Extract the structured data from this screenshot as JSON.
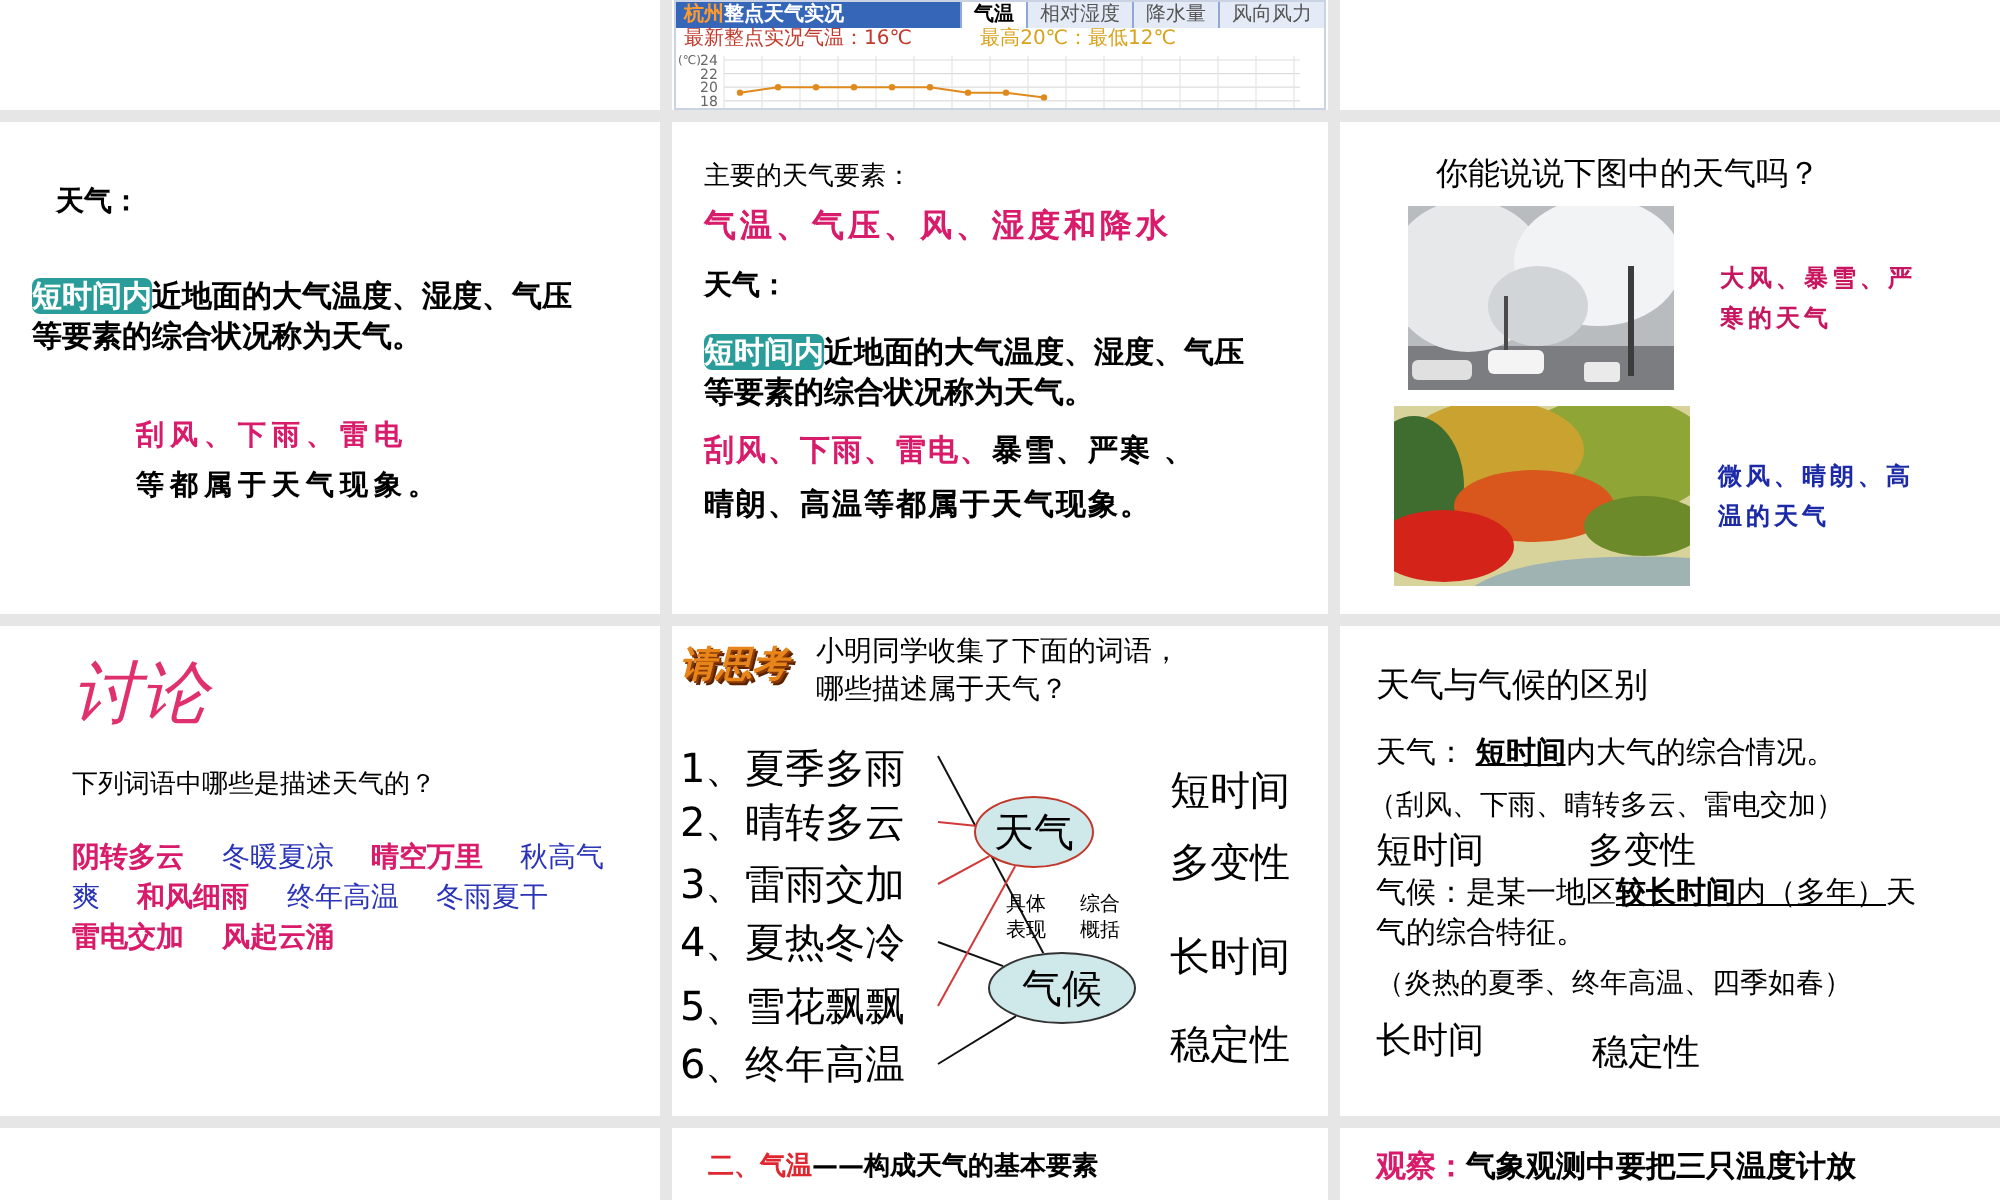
{
  "weather_widget": {
    "title_place": "杭州",
    "title": "整点天气实况",
    "tabs": [
      {
        "label": "气温",
        "selected": true
      },
      {
        "label": "相对湿度",
        "selected": false
      },
      {
        "label": "降水量",
        "selected": false
      },
      {
        "label": "风向风力",
        "selected": false
      }
    ],
    "unit": "(℃)",
    "current": "最新整点实况气温：16℃",
    "range": "最高20℃：最低12℃",
    "chart_data": {
      "type": "line",
      "ylim": [
        18,
        24
      ],
      "yticks": [
        18,
        20,
        22,
        24
      ],
      "series": [
        {
          "color": "#e08a1e",
          "marker": true,
          "values": [
            19.2,
            20,
            20,
            20,
            20,
            20,
            19.2,
            19.2,
            18.5
          ]
        }
      ]
    }
  },
  "slide_weather_definition": {
    "heading": "天气：",
    "definition": [
      {
        "text": "短时间内",
        "kind": "highlight"
      },
      {
        "text": "近地面的大气温度、湿度、气压等要素的综合状况称为天气。",
        "kind": "plain"
      }
    ],
    "examples": "刮风、下雨、雷电",
    "examples_note": "等都属于天气现象。"
  },
  "slide_weather_elements": {
    "intro": "主要的天气要素：",
    "elements": "气温、气压、风、湿度和降水",
    "heading": "天气：",
    "definition": [
      {
        "text": "短时间内",
        "kind": "highlight"
      },
      {
        "text": "近地面的大气温度、湿度、气压等要素的综合状况称为天气。",
        "kind": "plain"
      }
    ],
    "phenomena": [
      {
        "text": "刮风、下雨、雷电、",
        "kind": "pink"
      },
      {
        "text": "暴雪、严寒 、晴朗、高温等都属于天气现象。",
        "kind": "plain"
      }
    ]
  },
  "slide_pictures": {
    "question": "你能说说下图中的天气吗？",
    "pictures": [
      {
        "kind": "snow",
        "caption": "大风、暴雪、严寒的天气",
        "color": "#c8155f"
      },
      {
        "kind": "autumn",
        "caption": "微风、晴朗、高温的天气",
        "color": "#1c2aa8"
      }
    ]
  },
  "slide_discussion": {
    "title": "讨论",
    "question": "下列词语中哪些是描述天气的？",
    "words": [
      {
        "text": "阴转多云",
        "kind": "pink"
      },
      {
        "text": "冬暖夏凉",
        "kind": "blue"
      },
      {
        "text": "晴空万里",
        "kind": "pink"
      },
      {
        "text": "秋高气爽",
        "kind": "blue"
      },
      {
        "text": "和风细雨",
        "kind": "pink"
      },
      {
        "text": "终年高温",
        "kind": "blue"
      },
      {
        "text": "冬雨夏干",
        "kind": "blue"
      },
      {
        "text": "雷电交加",
        "kind": "pink"
      },
      {
        "text": "风起云涌",
        "kind": "pink"
      }
    ]
  },
  "slide_think": {
    "logo": "请思考",
    "question": [
      "小明同学收集了下面的词语，",
      "哪些描述属于天气？"
    ],
    "items": [
      {
        "text": "1、夏季多雨",
        "kind": "climate"
      },
      {
        "text": "2、晴转多云",
        "kind": "weather"
      },
      {
        "text": "3、雷雨交加",
        "kind": "weather"
      },
      {
        "text": "4、夏热冬冷",
        "kind": "climate"
      },
      {
        "text": "5、雪花飘飘",
        "kind": "weather"
      },
      {
        "text": "6、终年高温",
        "kind": "climate"
      }
    ],
    "weather": "天气",
    "climate": "气候",
    "concrete": [
      "具体",
      "表现"
    ],
    "general": [
      "综合",
      "概括"
    ],
    "traits": [
      "短时间",
      "多变性",
      "长时间",
      "稳定性"
    ]
  },
  "slide_difference": {
    "title": "天气与气候的区别",
    "weather_def": [
      {
        "text": "天气：  ",
        "kind": "plain"
      },
      {
        "text": "短时间",
        "kind": "bold_underline"
      },
      {
        "text": "内大气的综合情况。",
        "kind": "plain"
      }
    ],
    "weather_examples": "（刮风、下雨、晴转多云、雷电交加）",
    "weather_traits": [
      "短时间",
      "多变性"
    ],
    "climate_def": [
      {
        "text": "气候：是某一地区",
        "kind": "plain"
      },
      {
        "text": "较长时间",
        "kind": "bold_underline"
      },
      {
        "text": "内（多年）",
        "kind": "underline"
      },
      {
        "text": "天气的综合特征。",
        "kind": "plain"
      }
    ],
    "climate_examples": "（炎热的夏季、终年高温、四季如春）",
    "climate_traits": [
      "长时间",
      "稳定性"
    ]
  },
  "slide_temperature": [
    {
      "text": "二、气温",
      "kind": "red"
    },
    {
      "text": "——构成天气的基本要素",
      "kind": "plain"
    }
  ],
  "slide_observe": [
    {
      "text": "观察：",
      "kind": "pink"
    },
    {
      "text": "气象观测中要把三只温度计放",
      "kind": "plain"
    }
  ]
}
